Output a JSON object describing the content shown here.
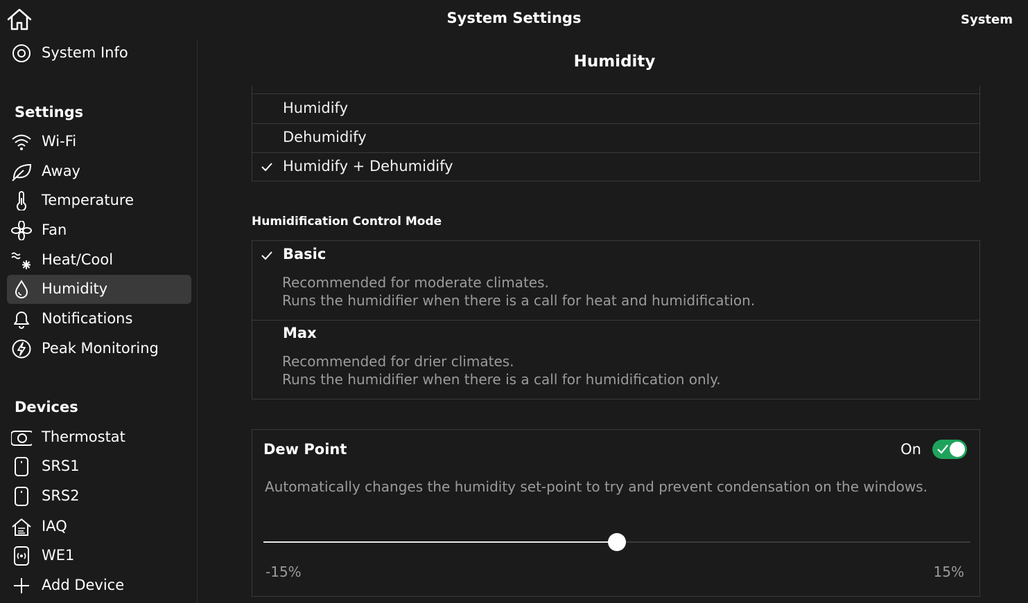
{
  "header": {
    "title": "System Settings",
    "right_label": "System",
    "home_icon": "home-icon"
  },
  "sidebar": {
    "system_info": {
      "label": "System Info",
      "icon": "target-icon"
    },
    "settings_heading": "Settings",
    "settings_items": [
      {
        "label": "Wi-Fi",
        "icon": "wifi-icon"
      },
      {
        "label": "Away",
        "icon": "leaf-icon"
      },
      {
        "label": "Temperature",
        "icon": "thermometer-icon"
      },
      {
        "label": "Fan",
        "icon": "fan-icon"
      },
      {
        "label": "Heat/Cool",
        "icon": "heat-cool-icon"
      },
      {
        "label": "Humidity",
        "icon": "droplet-icon",
        "active": true
      },
      {
        "label": "Notifications",
        "icon": "bell-icon"
      },
      {
        "label": "Peak Monitoring",
        "icon": "bolt-icon"
      }
    ],
    "devices_heading": "Devices",
    "device_items": [
      {
        "label": "Thermostat",
        "icon": "thermostat-icon"
      },
      {
        "label": "SRS1",
        "icon": "sensor-icon"
      },
      {
        "label": "SRS2",
        "icon": "sensor-icon"
      },
      {
        "label": "IAQ",
        "icon": "house-air-icon"
      },
      {
        "label": "WE1",
        "icon": "radio-device-icon"
      },
      {
        "label": "Add Device",
        "icon": "plus-icon"
      }
    ]
  },
  "main": {
    "title": "Humidity",
    "equipment_options": [
      {
        "label": "Humidify",
        "selected": false
      },
      {
        "label": "Dehumidify",
        "selected": false
      },
      {
        "label": "Humidify + Dehumidify",
        "selected": true
      }
    ],
    "control_mode": {
      "heading": "Humidification Control Mode",
      "options": [
        {
          "title": "Basic",
          "selected": true,
          "line1": "Recommended for moderate climates.",
          "line2": "Runs the humidifier when there is a call for heat and humidification."
        },
        {
          "title": "Max",
          "selected": false,
          "line1": "Recommended for drier climates.",
          "line2": "Runs the humidifier when there is a call for humidification only."
        }
      ]
    },
    "dew_point": {
      "title": "Dew Point",
      "state_label": "On",
      "enabled": true,
      "description": "Automatically changes the humidity set-point to try and prevent condensation on the windows.",
      "slider_min_label": "-15%",
      "slider_max_label": "15%",
      "slider_fraction": 0.5
    }
  },
  "colors": {
    "background": "#1b1b1b",
    "active_item": "#3a3a3a",
    "toggle_on": "#1fa35c",
    "muted_text": "#9b9b9b"
  }
}
